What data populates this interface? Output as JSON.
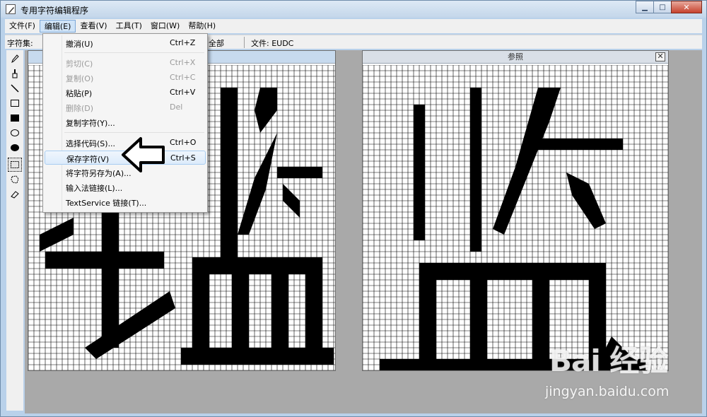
{
  "window": {
    "title": "专用字符编辑程序"
  },
  "menubar": {
    "items": [
      {
        "label": "文件(F)"
      },
      {
        "label": "编辑(E)"
      },
      {
        "label": "查看(V)"
      },
      {
        "label": "工具(T)"
      },
      {
        "label": "窗口(W)"
      },
      {
        "label": "帮助(H)"
      }
    ]
  },
  "charbar": {
    "charset_label": "字符集:",
    "charset_value_fragment": "全部",
    "file_label": "文件: EUDC"
  },
  "edit_menu": {
    "items": [
      {
        "label": "撤消(U)",
        "accel": "Ctrl+Z",
        "enabled": true
      },
      {
        "label": "剪切(C)",
        "accel": "Ctrl+X",
        "enabled": false
      },
      {
        "label": "复制(O)",
        "accel": "Ctrl+C",
        "enabled": false
      },
      {
        "label": "粘贴(P)",
        "accel": "Ctrl+V",
        "enabled": true
      },
      {
        "label": "删除(D)",
        "accel": "Del",
        "enabled": false
      },
      {
        "label": "复制字符(Y)...",
        "accel": "",
        "enabled": true
      },
      {
        "label": "选择代码(S)...",
        "accel": "Ctrl+O",
        "enabled": true
      },
      {
        "label": "保存字符(V)",
        "accel": "Ctrl+S",
        "enabled": true,
        "highlighted": true
      },
      {
        "label": "将字符另存为(A)...",
        "accel": "",
        "enabled": true
      },
      {
        "label": "输入法链接(L)...",
        "accel": "",
        "enabled": true
      },
      {
        "label": "TextService 链接(T)...",
        "accel": "",
        "enabled": true
      }
    ]
  },
  "reference_panel": {
    "title": "参照",
    "close_glyph": "✕"
  },
  "toolbox": {
    "tools": [
      "pencil-icon",
      "brush-icon",
      "line-icon",
      "hollow-rect-icon",
      "filled-rect-icon",
      "hollow-ellipse-icon",
      "filled-ellipse-icon",
      "rect-select-icon",
      "freeform-select-icon",
      "eraser-icon"
    ],
    "selected": "rect-select-icon"
  },
  "watermark": {
    "brand": "Bai 经验",
    "url": "jingyan.baidu.com"
  },
  "colors": {
    "accent": "#3399ff",
    "pixel_on": "#000000",
    "grid_line": "#000000"
  }
}
